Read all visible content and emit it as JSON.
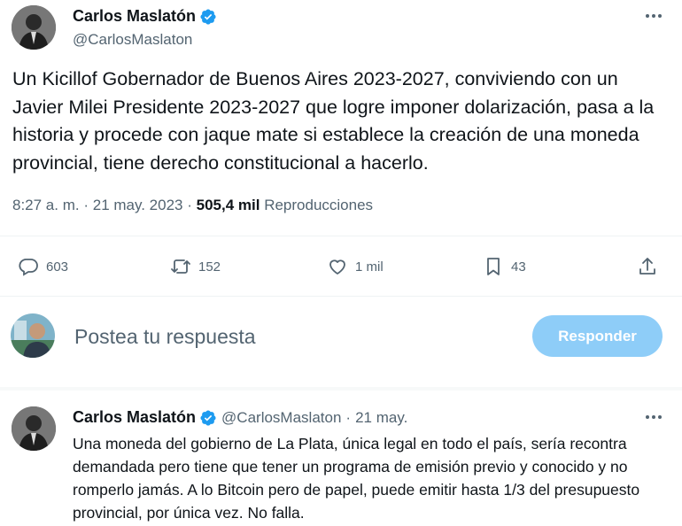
{
  "tweet": {
    "author": {
      "display_name": "Carlos Maslatón",
      "handle": "@CarlosMaslaton",
      "verified": true
    },
    "text": "Un Kicillof Gobernador de Buenos Aires 2023-2027, conviviendo con un Javier Milei Presidente 2023-2027 que logre imponer dolarización, pasa a la historia y procede con jaque mate si establece la creación de una moneda provincial, tiene derecho constitucional a hacerlo.",
    "time": "8:27 a. m.",
    "date": "21 may. 2023",
    "views_count": "505,4 mil",
    "views_label": "Reproducciones",
    "actions": {
      "replies": "603",
      "retweets": "152",
      "likes": "1 mil",
      "bookmarks": "43"
    }
  },
  "composer": {
    "placeholder": "Postea tu respuesta",
    "button_label": "Responder"
  },
  "reply": {
    "display_name": "Carlos Maslatón",
    "handle": "@CarlosMaslaton",
    "separator": "·",
    "date": "21 may.",
    "text": "Una moneda del gobierno de La Plata, única legal en todo el país, sería recontra demandada pero tiene que tener un programa de emisión previo y conocido y no romperlo jamás. A lo Bitcoin pero de papel, puede emitir hasta 1/3 del presupuesto provincial, por única vez. No falla."
  },
  "colors": {
    "accent": "#1d9bf0",
    "button_disabled": "#8ecdf8",
    "secondary_text": "#536471",
    "primary_text": "#0f1419"
  }
}
